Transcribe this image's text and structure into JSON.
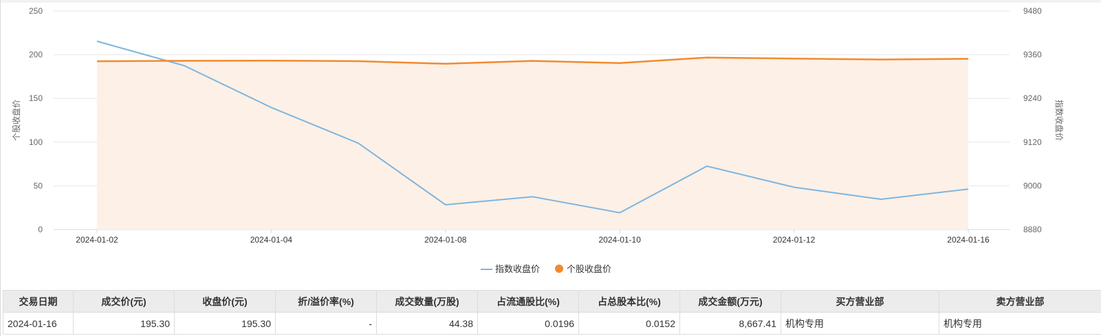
{
  "chart_data": {
    "type": "line",
    "x": [
      "2024-01-02",
      "2024-01-03",
      "2024-01-04",
      "2024-01-05",
      "2024-01-08",
      "2024-01-09",
      "2024-01-10",
      "2024-01-11",
      "2024-01-12",
      "2024-01-15",
      "2024-01-16"
    ],
    "x_tick_labels": [
      "2024-01-02",
      "2024-01-04",
      "2024-01-08",
      "2024-01-10",
      "2024-01-12",
      "2024-01-16"
    ],
    "ylabel_left": "个股收盘价",
    "ylabel_right": "指数收盘价",
    "ylim_left": [
      0,
      250
    ],
    "yticks_left": [
      0,
      50,
      100,
      150,
      200,
      250
    ],
    "ylim_right": [
      8880,
      9480
    ],
    "yticks_right": [
      8880,
      9000,
      9120,
      9240,
      9360,
      9480
    ],
    "grid": true,
    "legend_position": "bottom-center",
    "series": [
      {
        "name": "指数收盘价",
        "axis": "right",
        "style": "line",
        "color": "#7cb5e0",
        "values": [
          9397,
          9330,
          9215,
          9117,
          8948,
          8970,
          8926,
          9054,
          8996,
          8963,
          8991
        ]
      },
      {
        "name": "个股收盘价",
        "axis": "left",
        "style": "area",
        "color": "#f28a2e",
        "fill": "#fdf0e6",
        "values": [
          192.5,
          193.0,
          193.2,
          192.6,
          189.6,
          192.9,
          190.4,
          196.8,
          195.6,
          194.5,
          195.3
        ]
      }
    ]
  },
  "table": {
    "headers": [
      "交易日期",
      "成交价(元)",
      "收盘价(元)",
      "折/溢价率(%)",
      "成交数量(万股)",
      "占流通股比(%)",
      "占总股本比(%)",
      "成交金额(万元)",
      "买方营业部",
      "卖方营业部"
    ],
    "rows": [
      [
        "2024-01-16",
        "195.30",
        "195.30",
        "-",
        "44.38",
        "0.0196",
        "0.0152",
        "8,667.41",
        "机构专用",
        "机构专用"
      ]
    ]
  },
  "colors": {
    "grid": "#e6e6e6",
    "axis_text": "#666666",
    "header_bg": "#ececec"
  }
}
